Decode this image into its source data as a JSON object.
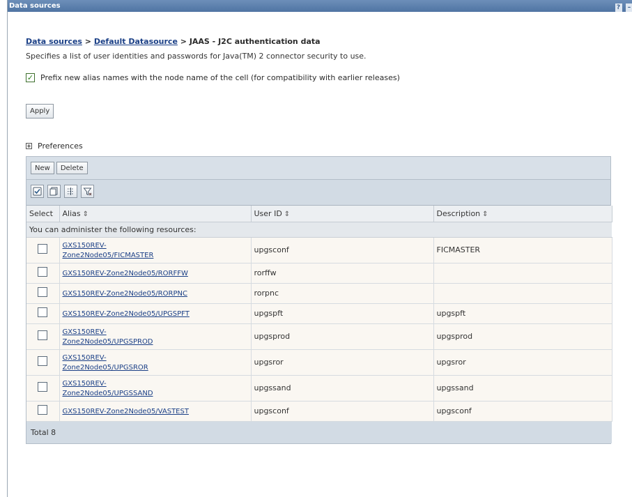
{
  "window": {
    "title": "Data sources",
    "help_icon": "?",
    "min_icon": "–"
  },
  "breadcrumb": {
    "part1": "Data sources",
    "sep1": " > ",
    "part2": "Default Datasource",
    "sep2": " > ",
    "current": "JAAS - J2C authentication data"
  },
  "description": "Specifies a list of user identities and passwords for Java(TM) 2 connector security to use.",
  "prefix_option": {
    "checked": true,
    "label": "Prefix new alias names with the node name of the cell (for compatibility with earlier releases)"
  },
  "apply_label": "Apply",
  "preferences": {
    "expand_icon": "+",
    "label": "Preferences"
  },
  "toolbar": {
    "new_label": "New",
    "delete_label": "Delete"
  },
  "icons": [
    "select-all-icon",
    "deselect-all-icon",
    "show-filter-icon",
    "clear-filter-icon"
  ],
  "table": {
    "headers": {
      "select": "Select",
      "alias": "Alias",
      "user_id": "User ID",
      "description": "Description",
      "sort_glyph": "⇕"
    },
    "admin_message": "You can administer the following resources:",
    "rows": [
      {
        "alias_l1": "GXS150REV-",
        "alias_l2": "Zone2Node05/FICMASTER",
        "user": "upgsconf",
        "desc": "FICMASTER"
      },
      {
        "alias_l1": "GXS150REV-Zone2Node05/RORFFW",
        "alias_l2": "",
        "user": "rorffw",
        "desc": ""
      },
      {
        "alias_l1": "GXS150REV-Zone2Node05/RORPNC",
        "alias_l2": "",
        "user": "rorpnc",
        "desc": ""
      },
      {
        "alias_l1": "GXS150REV-Zone2Node05/UPGSPFT",
        "alias_l2": "",
        "user": "upgspft",
        "desc": "upgspft"
      },
      {
        "alias_l1": "GXS150REV-",
        "alias_l2": "Zone2Node05/UPGSPROD",
        "user": "upgsprod",
        "desc": "upgsprod"
      },
      {
        "alias_l1": "GXS150REV-",
        "alias_l2": "Zone2Node05/UPGSROR",
        "user": "upgsror",
        "desc": "upgsror"
      },
      {
        "alias_l1": "GXS150REV-",
        "alias_l2": "Zone2Node05/UPGSSAND",
        "user": "upgssand",
        "desc": "upgssand"
      },
      {
        "alias_l1": "GXS150REV-Zone2Node05/VASTEST",
        "alias_l2": "",
        "user": "upgsconf",
        "desc": "upgsconf"
      }
    ],
    "total": "Total 8"
  }
}
